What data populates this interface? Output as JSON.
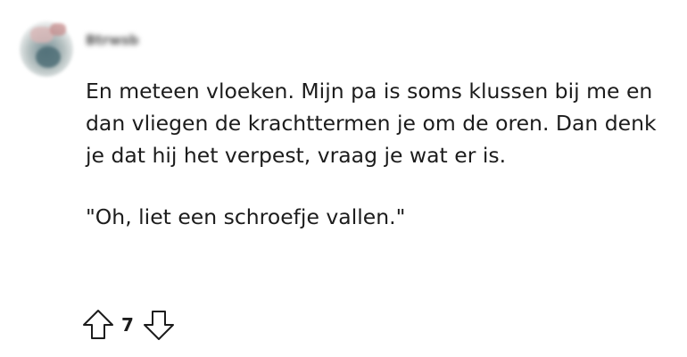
{
  "comment": {
    "username": "Btrwsb",
    "paragraphs": [
      "En meteen vloeken. Mijn pa is soms klussen bij me en dan vliegen de krachttermen je om de oren. Dan denk je dat hij het verpest, vraag je wat er is.",
      "\"Oh, liet een schroefje vallen.\""
    ],
    "score": "7",
    "icons": {
      "upvote": "arrow-up-outline-icon",
      "downvote": "arrow-down-outline-icon",
      "avatar": "user-avatar"
    }
  }
}
